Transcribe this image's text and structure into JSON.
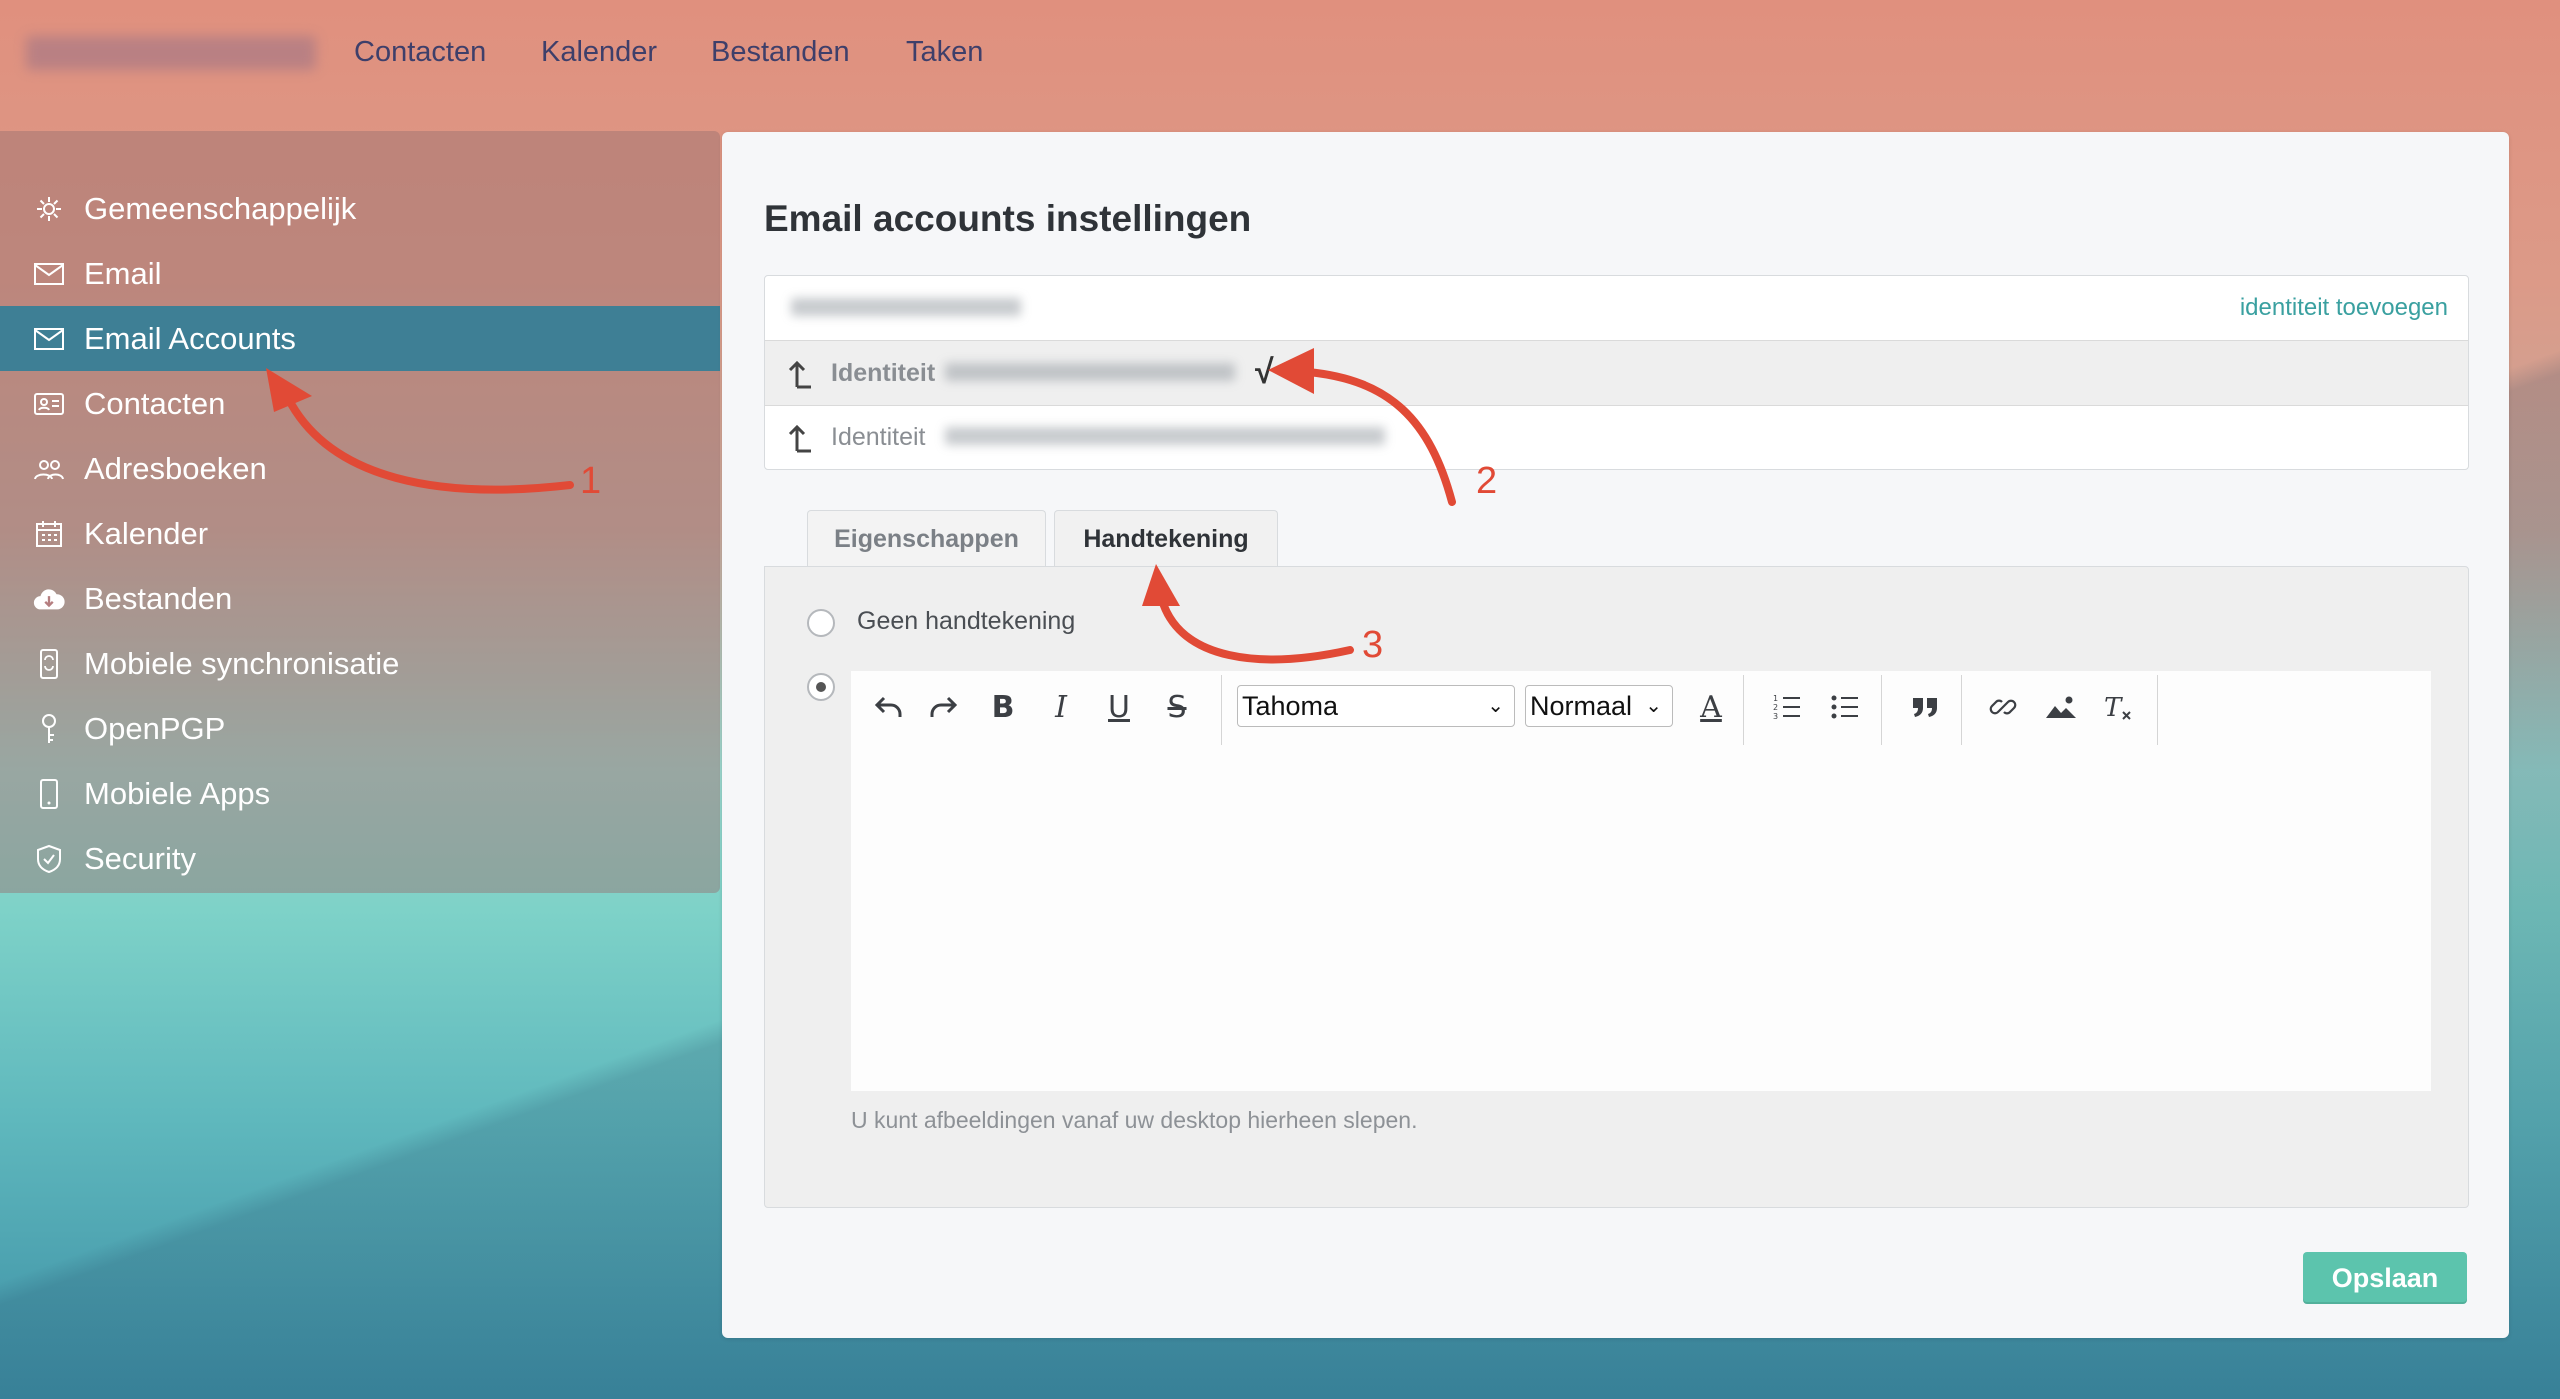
{
  "topnav": {
    "items": [
      "Contacten",
      "Kalender",
      "Bestanden",
      "Taken"
    ]
  },
  "sidebar": {
    "items": [
      {
        "label": "Gemeenschappelijk",
        "icon": "gear-icon"
      },
      {
        "label": "Email",
        "icon": "envelope-icon"
      },
      {
        "label": "Email Accounts",
        "icon": "envelope-icon",
        "active": true
      },
      {
        "label": "Contacten",
        "icon": "contact-card-icon"
      },
      {
        "label": "Adresboeken",
        "icon": "people-icon"
      },
      {
        "label": "Kalender",
        "icon": "calendar-icon"
      },
      {
        "label": "Bestanden",
        "icon": "cloud-download-icon"
      },
      {
        "label": "Mobiele synchronisatie",
        "icon": "mobile-sync-icon"
      },
      {
        "label": "OpenPGP",
        "icon": "key-icon"
      },
      {
        "label": "Mobiele Apps",
        "icon": "mobile-icon"
      },
      {
        "label": "Security",
        "icon": "shield-icon"
      }
    ]
  },
  "main": {
    "title": "Email accounts instellingen",
    "add_identity": "identiteit toevoegen",
    "identities": [
      {
        "label": "Identiteit",
        "selected": true,
        "check": "√"
      },
      {
        "label": "Identiteit",
        "selected": false
      }
    ],
    "tabs": [
      {
        "label": "Eigenschappen",
        "active": false
      },
      {
        "label": "Handtekening",
        "active": true
      }
    ],
    "signature": {
      "no_signature_label": "Geen handtekening",
      "font": "Tahoma",
      "size": "Normaal",
      "hint": "U kunt afbeeldingen vanaf uw desktop hierheen slepen."
    },
    "save_label": "Opslaan"
  },
  "annotations": {
    "numbers": [
      "1",
      "2",
      "3"
    ],
    "color": "#e14a36"
  },
  "colors": {
    "active_sidebar": "#3e7f95",
    "save_button": "#5cc4ad",
    "link": "#3aa0a0"
  }
}
